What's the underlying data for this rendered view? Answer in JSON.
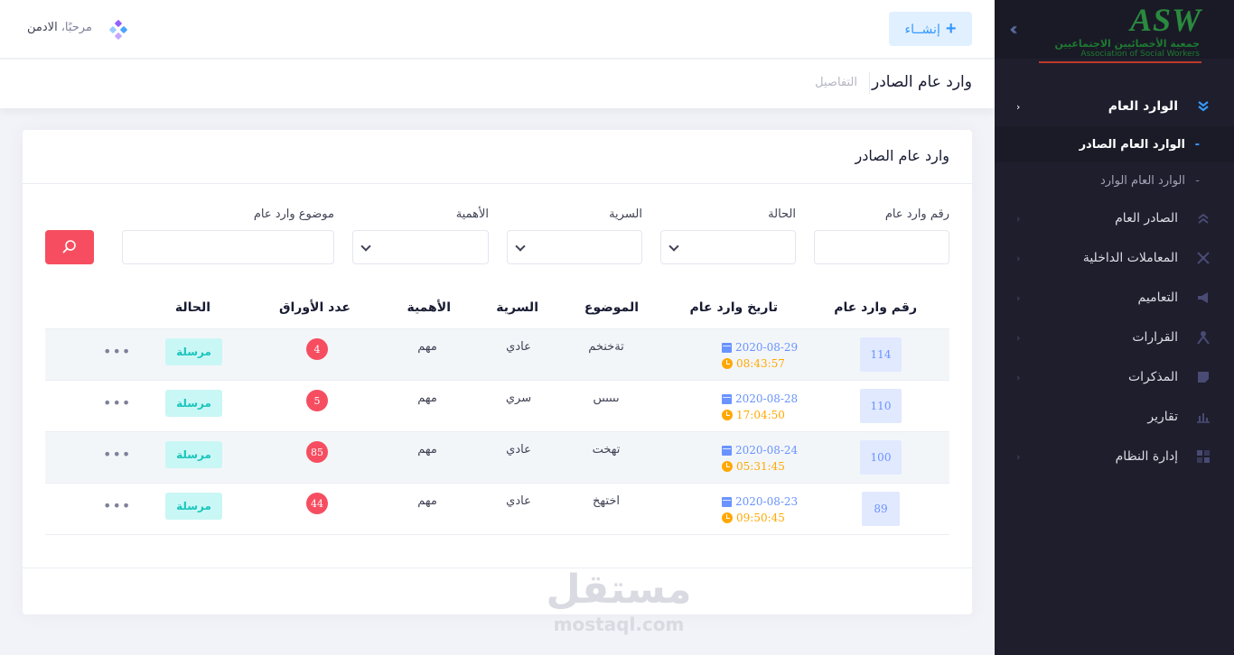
{
  "header": {
    "create_label": "إنشــاء",
    "greeting": "مرحبًا،",
    "username": "الادمن"
  },
  "subheader": {
    "title": "وارد عام الصادر",
    "breadcrumb": "التفاصيل"
  },
  "sidebar": {
    "logo": {
      "mark": "ASW",
      "arabic": "جمعية الأخصائيين الاجتماعيين",
      "english": "Association of Social Workers"
    },
    "menu": [
      {
        "label": "الوارد العام",
        "icon": "angle-double-down-icon",
        "open": true,
        "children": [
          {
            "label": "الوارد العام الصادر",
            "active": true
          },
          {
            "label": "الوارد العام الوارد",
            "active": false
          }
        ]
      },
      {
        "label": "الصادر العام",
        "icon": "angle-double-up-icon"
      },
      {
        "label": "المعاملات الداخلية",
        "icon": "arrows-icon"
      },
      {
        "label": "التعاميم",
        "icon": "megaphone-icon"
      },
      {
        "label": "القرارات",
        "icon": "user-tie-icon"
      },
      {
        "label": "المذكرات",
        "icon": "sticky-note-icon"
      },
      {
        "label": "تقارير",
        "icon": "chart-bar-icon"
      },
      {
        "label": "إدارة النظام",
        "icon": "layout-icon"
      }
    ]
  },
  "card": {
    "title": "وارد عام الصادر"
  },
  "filters": {
    "number_label": "رقم وارد عام",
    "status_label": "الحالة",
    "secrecy_label": "السرية",
    "importance_label": "الأهمية",
    "subject_label": "موضوع وارد عام"
  },
  "table": {
    "columns": [
      "رقم وارد عام",
      "تاريخ وارد عام",
      "الموضوع",
      "السرية",
      "الأهمية",
      "عدد الأوراق",
      "الحالة"
    ],
    "rows": [
      {
        "number": "114",
        "date": "2020-08-29",
        "time": "08:43:57",
        "subject": "تةخنخم",
        "secrecy": "عادي",
        "importance": "مهم",
        "pages": "4",
        "status": "مرسلة"
      },
      {
        "number": "110",
        "date": "2020-08-28",
        "time": "17:04:50",
        "subject": "ںںںںںں",
        "secrecy": "سري",
        "importance": "مهم",
        "pages": "5",
        "status": "مرسلة"
      },
      {
        "number": "100",
        "date": "2020-08-24",
        "time": "05:31:45",
        "subject": "تهخت",
        "secrecy": "عادي",
        "importance": "مهم",
        "pages": "85",
        "status": "مرسلة"
      },
      {
        "number": "89",
        "date": "2020-08-23",
        "time": "09:50:45",
        "subject": "اختهخ",
        "secrecy": "عادي",
        "importance": "مهم",
        "pages": "44",
        "status": "مرسلة"
      }
    ]
  },
  "watermark": {
    "arabic": "مستقل",
    "english": "mostaql.com"
  },
  "colors": {
    "primary": "#3699ff",
    "danger": "#f64e60",
    "warning": "#ffa800",
    "success_bg": "#c9f7f5",
    "success": "#1bc5bd",
    "sidebar_bg": "#1e1e2d"
  }
}
